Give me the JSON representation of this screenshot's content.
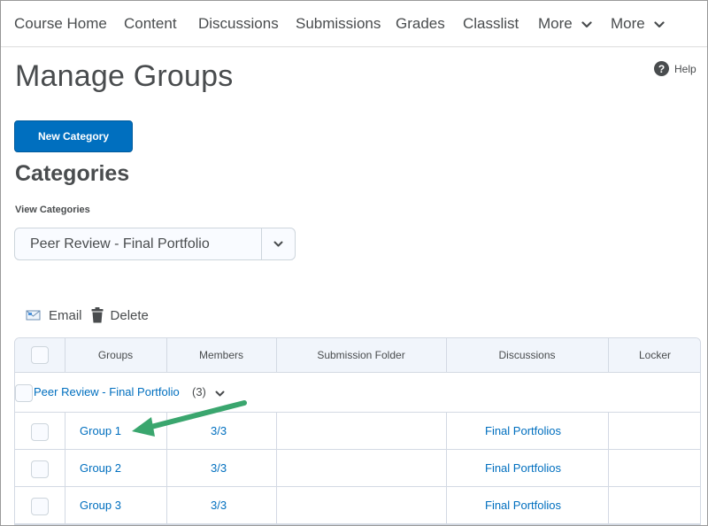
{
  "nav": {
    "items": [
      "Course Home",
      "Content",
      "Discussions",
      "Submissions",
      "Grades",
      "Classlist",
      "More",
      "More"
    ]
  },
  "page": {
    "title": "Manage Groups",
    "help_label": "Help",
    "help_icon": "?"
  },
  "toolbar": {
    "new_category_label": "New Category"
  },
  "categories": {
    "title": "Categories",
    "view_label": "View Categories",
    "selected": "Peer Review - Final Portfolio"
  },
  "actions": {
    "email_label": "Email",
    "delete_label": "Delete"
  },
  "table": {
    "headers": [
      "Groups",
      "Members",
      "Submission Folder",
      "Discussions",
      "Locker"
    ],
    "category_row": {
      "name": "Peer Review - Final Portfolio",
      "count": "(3)"
    },
    "rows": [
      {
        "group": "Group 1",
        "members": "3/3",
        "submission_folder": "",
        "discussions": "Final Portfolios",
        "locker": ""
      },
      {
        "group": "Group 2",
        "members": "3/3",
        "submission_folder": "",
        "discussions": "Final Portfolios",
        "locker": ""
      },
      {
        "group": "Group 3",
        "members": "3/3",
        "submission_folder": "",
        "discussions": "Final Portfolios",
        "locker": ""
      }
    ]
  },
  "colors": {
    "accent": "#006fbf",
    "text": "#494c4e",
    "annotation_arrow": "#3aa66e"
  }
}
